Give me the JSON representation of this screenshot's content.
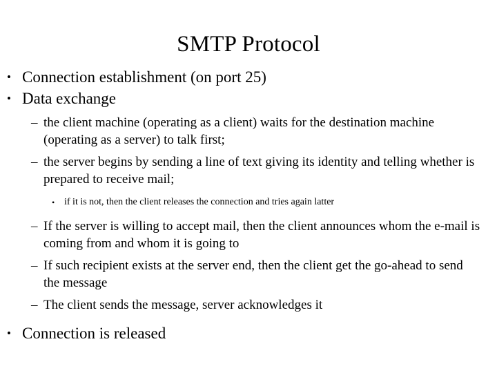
{
  "slide": {
    "title": "SMTP Protocol",
    "markers": {
      "level1": "•",
      "level2": "–",
      "level3": "•"
    },
    "bullets": [
      {
        "level": 1,
        "text": "Connection establishment (on port 25)"
      },
      {
        "level": 1,
        "text": "Data exchange"
      },
      {
        "level": 2,
        "text": "the client machine (operating as a client) waits for the destination machine (operating as a server) to talk first;"
      },
      {
        "level": 2,
        "text": "the server begins by sending a line of text giving its identity and telling whether is prepared to receive mail;"
      },
      {
        "level": 3,
        "text": "if it is not, then the client releases the connection and tries again latter"
      },
      {
        "level": 2,
        "text": "If the server is willing to accept mail, then the client announces whom the e-mail is coming from and whom it is going to"
      },
      {
        "level": 2,
        "text": "If such recipient exists at the server end, then the client get the go-ahead to send the message"
      },
      {
        "level": 2,
        "text": "The client sends the message, server acknowledges it"
      },
      {
        "level": 1,
        "text": "Connection is released"
      }
    ]
  }
}
